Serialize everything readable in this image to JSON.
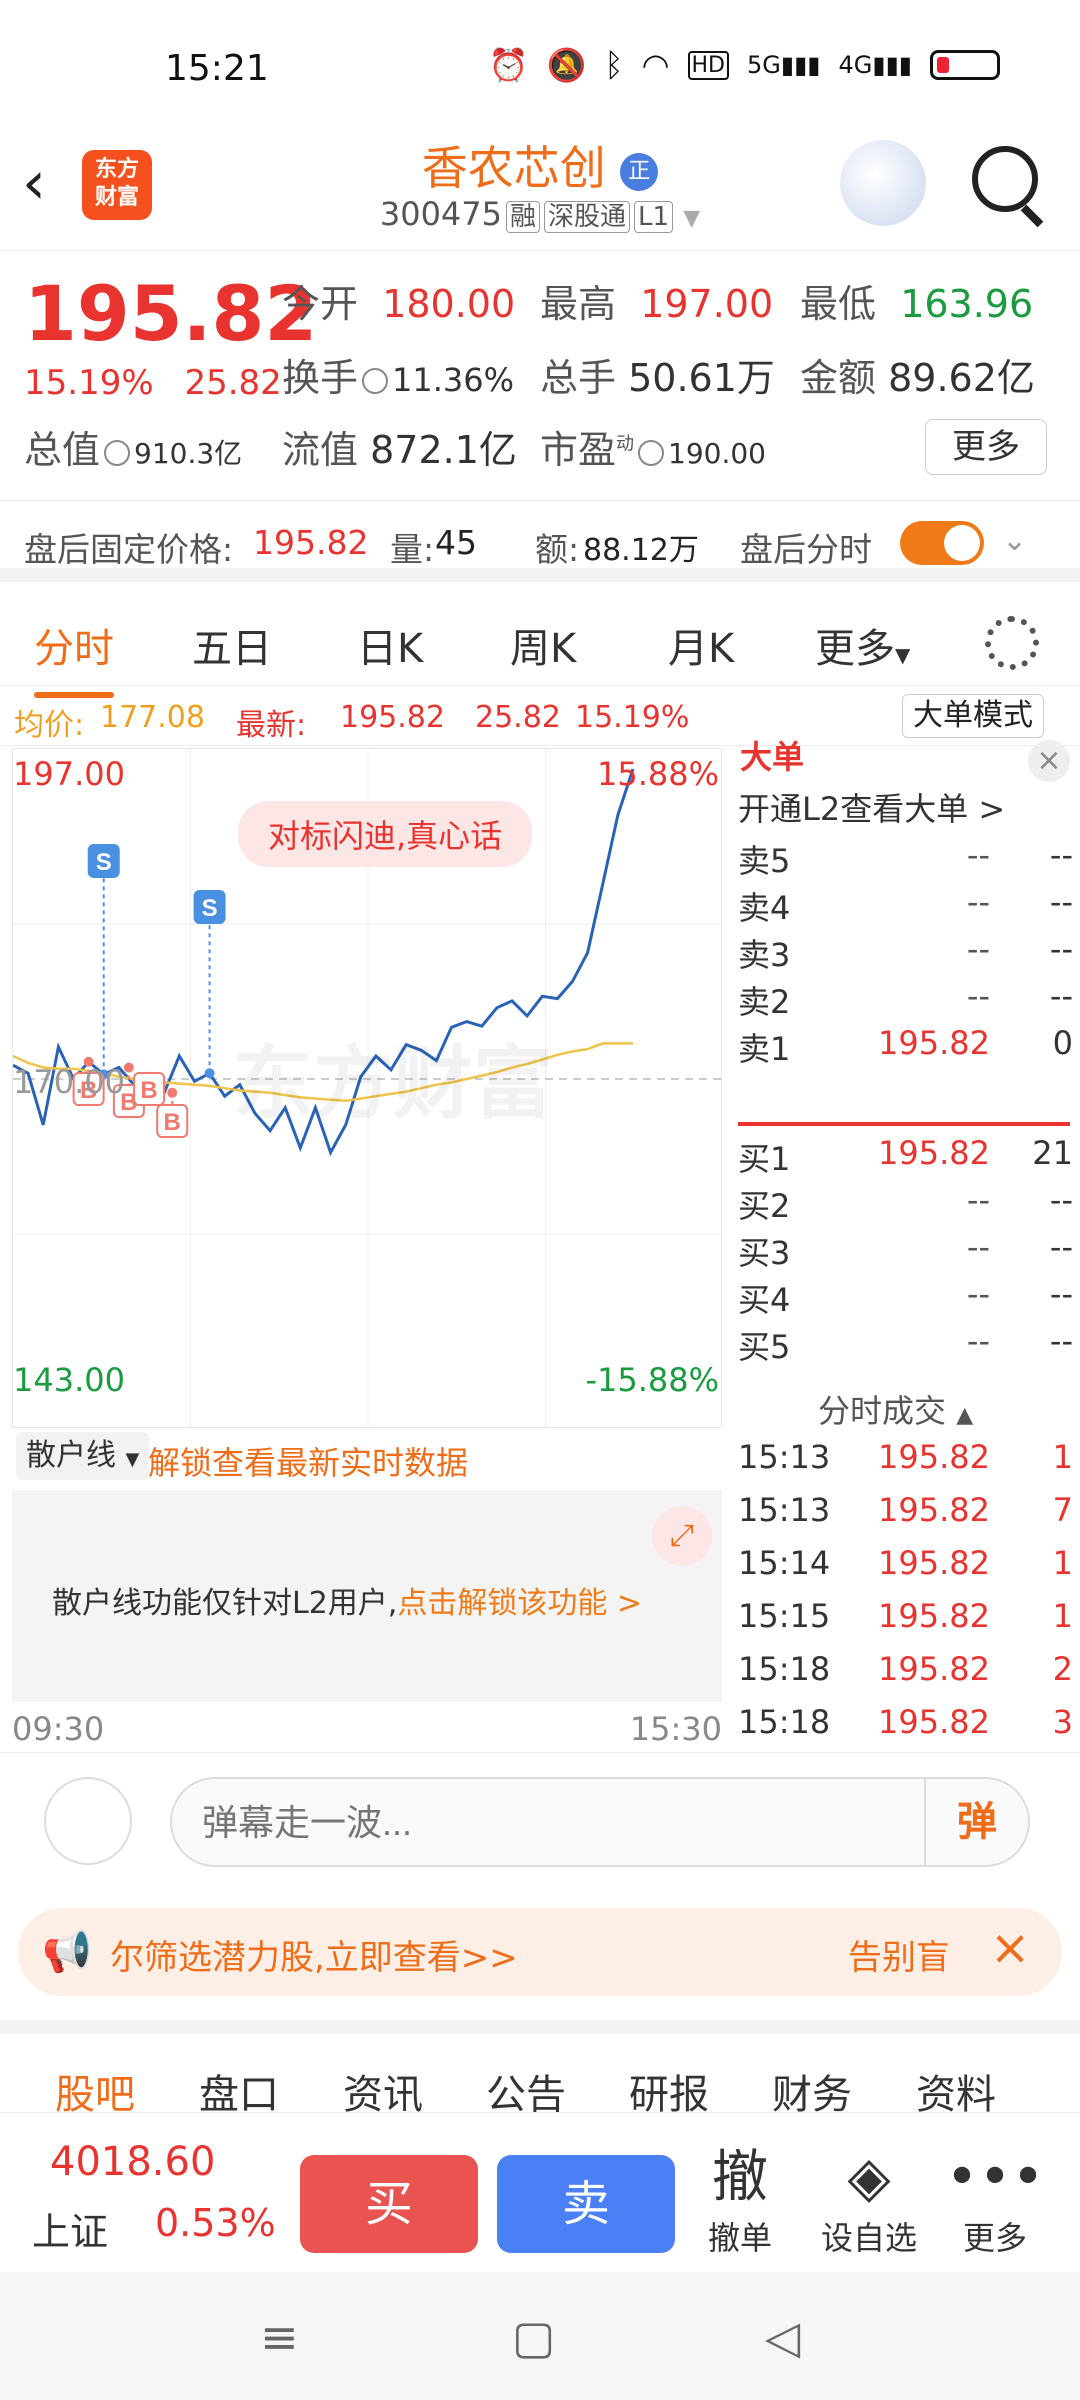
{
  "status": {
    "time": "15:21",
    "icons": [
      "alarm-icon",
      "mute-icon",
      "bluetooth-icon",
      "wifi-icon",
      "hd-icon",
      "5g-signal-icon",
      "4g-signal-icon",
      "battery-icon"
    ],
    "hd": "HD",
    "net1": "5G",
    "net2": "4G"
  },
  "header": {
    "logo_line1": "东方",
    "logo_line2": "财富",
    "title": "香农芯创",
    "title_badge": "正",
    "code": "300475",
    "tag1": "融",
    "tag2": "深股通",
    "tag3": "L1"
  },
  "quote": {
    "price": "195.82",
    "pct": "15.19%",
    "chg": "25.82",
    "open_label": "今开",
    "open": "180.00",
    "high_label": "最高",
    "high": "197.00",
    "low_label": "最低",
    "low": "163.96",
    "turnover_label": "换手",
    "turnover": "11.36%",
    "volume_label": "总手",
    "volume": "50.61万",
    "amount_label": "金额",
    "amount": "89.62亿",
    "mktcap_label": "总值",
    "mktcap": "910.3亿",
    "float_label": "流值",
    "float": "872.1亿",
    "pe_label": "市盈",
    "pe_sup": "动",
    "pe": "190.00",
    "more": "更多"
  },
  "afterhours": {
    "price_label": "盘后固定价格:",
    "price": "195.82",
    "vol_label": "量:",
    "vol": "45",
    "amt_label": "额:",
    "amt": "88.12万",
    "toggle_label": "盘后分时"
  },
  "tabs": [
    "分时",
    "五日",
    "日K",
    "周K",
    "月K",
    "更多"
  ],
  "avg": {
    "avg_label": "均价:",
    "avg": "177.08",
    "latest_label": "最新:",
    "latest": "195.82",
    "chg": "25.82",
    "pct": "15.19%",
    "big_mode": "大单模式"
  },
  "chart": {
    "ymax": "197.00",
    "ymin": "143.00",
    "mid": "170.00",
    "pmax": "15.88%",
    "pmin": "-15.88%",
    "banner": "对标闪迪,真心话",
    "watermark": "东方财富",
    "xstart": "09:30",
    "xend": "15:30",
    "markers": [
      "S",
      "S",
      "B",
      "B",
      "B",
      "B"
    ]
  },
  "chart_data": {
    "type": "line",
    "title": "",
    "xlabel": "",
    "ylabel": "",
    "x_range": [
      "09:30",
      "15:30"
    ],
    "ylim": [
      143.0,
      197.0
    ],
    "baseline": 170.0,
    "series": [
      {
        "values": [
          171.2,
          170.5,
          166.0,
          172.8,
          170.0,
          171.5,
          170.4,
          171.0,
          169.5,
          170.2,
          168.8,
          172.0,
          169.8,
          170.5,
          168.5,
          169.5,
          167.0,
          165.5,
          167.5,
          164.0,
          167.5,
          163.6,
          166.0,
          170.2,
          172.0,
          170.8,
          173.0,
          172.5,
          171.6,
          174.5,
          175.0,
          174.6,
          176.2,
          176.8,
          175.5,
          177.2,
          177.0,
          178.5,
          181.0,
          187.0,
          193.0,
          197.0
        ]
      },
      {
        "values": [
          172.0,
          171.4,
          171.0,
          170.9,
          170.9,
          170.7,
          170.5,
          170.2,
          170.0,
          169.9,
          169.7,
          169.6,
          169.5,
          169.4,
          169.2,
          169.0,
          168.9,
          168.8,
          168.6,
          168.4,
          168.3,
          168.2,
          168.1,
          168.3,
          168.5,
          168.7,
          168.9,
          169.2,
          169.5,
          169.7,
          170.0,
          170.3,
          170.6,
          171.0,
          171.3,
          171.7,
          172.1,
          172.4,
          172.6,
          173.1,
          173.1,
          173.1
        ]
      }
    ]
  },
  "retail": {
    "select": "散户线",
    "unlock": "解锁查看最新实时数据",
    "notice": "散户线功能仅针对L2用户,",
    "notice_link": "点击解锁该功能 >"
  },
  "orderbook": {
    "big_title": "大单",
    "open_l2": "开通L2查看大单 >",
    "asks": [
      {
        "l": "卖5",
        "p": "--",
        "v": "--"
      },
      {
        "l": "卖4",
        "p": "--",
        "v": "--"
      },
      {
        "l": "卖3",
        "p": "--",
        "v": "--"
      },
      {
        "l": "卖2",
        "p": "--",
        "v": "--"
      },
      {
        "l": "卖1",
        "p": "195.82",
        "v": "0"
      }
    ],
    "bids": [
      {
        "l": "买1",
        "p": "195.82",
        "v": "21"
      },
      {
        "l": "买2",
        "p": "--",
        "v": "--"
      },
      {
        "l": "买3",
        "p": "--",
        "v": "--"
      },
      {
        "l": "买4",
        "p": "--",
        "v": "--"
      },
      {
        "l": "买5",
        "p": "--",
        "v": "--"
      }
    ],
    "ticks_title": "分时成交",
    "ticks": [
      {
        "t": "15:13",
        "p": "195.82",
        "v": "1"
      },
      {
        "t": "15:13",
        "p": "195.82",
        "v": "7"
      },
      {
        "t": "15:14",
        "p": "195.82",
        "v": "1"
      },
      {
        "t": "15:15",
        "p": "195.82",
        "v": "1"
      },
      {
        "t": "15:18",
        "p": "195.82",
        "v": "2"
      },
      {
        "t": "15:18",
        "p": "195.82",
        "v": "3"
      }
    ]
  },
  "barrage": {
    "placeholder": "弹幕走一波...",
    "danmu": "弹"
  },
  "promo": {
    "msg": "尔筛选潜力股,立即查看>>",
    "bye": "告别盲"
  },
  "subtabs": [
    "股吧",
    "盘口",
    "资讯",
    "公告",
    "研报",
    "财务",
    "资料"
  ],
  "bottom": {
    "index_value": "4018.60",
    "index_name": "上证",
    "index_pct": "0.53%",
    "buy": "买",
    "sell": "卖",
    "cancel_glyph": "撤",
    "cancel": "撤单",
    "watch": "设自选",
    "more": "更多"
  },
  "colors": {
    "up": "#e8332f",
    "down": "#1a9b3f",
    "accent": "#ef6c19",
    "line": "#2a62b8",
    "avg": "#f0c34a"
  }
}
